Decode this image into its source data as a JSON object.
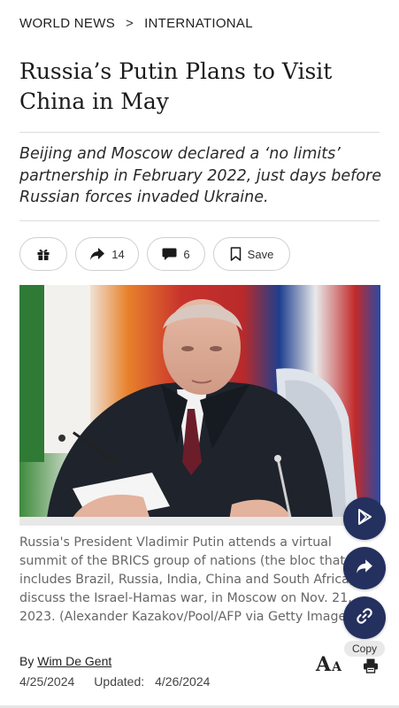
{
  "breadcrumb": {
    "section": "WORLD NEWS",
    "separator": ">",
    "subsection": "INTERNATIONAL"
  },
  "article": {
    "title": "Russia’s Putin Plans to Visit China in May",
    "subtitle": "Beijing and Moscow declared a ‘no limits’ partnership in February 2022, just days before Russian forces invaded Ukraine.",
    "caption": "Russia's President Vladimir Putin attends a virtual summit of the BRICS group of nations (the bloc that includes Brazil, Russia, India, China and South Africa) to discuss the Israel-Hamas war, in Moscow on Nov. 21, 2023. (Alexander Kazakov/Pool/AFP via Getty Images)",
    "byline_prefix": "By",
    "author": "Wim De Gent",
    "published": "4/25/2024",
    "updated_label": "Updated:",
    "updated": "4/26/2024"
  },
  "actions": {
    "share_count": "14",
    "comment_count": "6",
    "save_label": "Save"
  },
  "floating": {
    "copy_label": "Copy"
  },
  "icons": [
    "gift-icon",
    "share-arrow-icon",
    "comment-icon",
    "bookmark-icon",
    "play-icon",
    "link-icon",
    "text-size-icon",
    "print-icon"
  ],
  "colors": {
    "fab": "#24305e",
    "pill_border": "#cfcfcf",
    "caption": "#666666"
  }
}
